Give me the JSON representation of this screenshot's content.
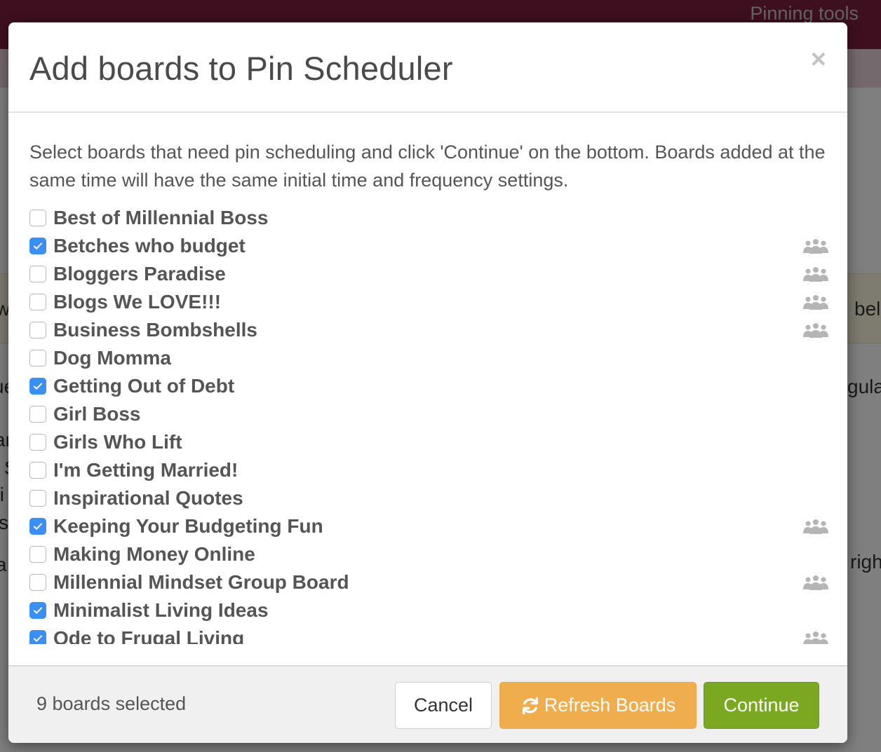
{
  "background": {
    "nav_link": "Pinning tools",
    "fragments_left": [
      "wc",
      "ue",
      "ar",
      "S",
      "ti",
      "s",
      "a"
    ],
    "fragments_right": [
      "belo",
      "gular",
      "righ"
    ]
  },
  "modal": {
    "title": "Add boards to Pin Scheduler",
    "close_label": "×",
    "intro": "Select boards that need pin scheduling and click 'Continue' on the bottom. Boards added at the same time will have the same initial time and frequency settings.",
    "boards": [
      {
        "name": "Best of Millennial Boss",
        "checked": false,
        "group": false
      },
      {
        "name": "Betches who budget",
        "checked": true,
        "group": true
      },
      {
        "name": "Bloggers Paradise",
        "checked": false,
        "group": true
      },
      {
        "name": "Blogs We LOVE!!!",
        "checked": false,
        "group": true
      },
      {
        "name": "Business Bombshells",
        "checked": false,
        "group": true
      },
      {
        "name": "Dog Momma",
        "checked": false,
        "group": false
      },
      {
        "name": "Getting Out of Debt",
        "checked": true,
        "group": false
      },
      {
        "name": "Girl Boss",
        "checked": false,
        "group": false
      },
      {
        "name": "Girls Who Lift",
        "checked": false,
        "group": false
      },
      {
        "name": "I'm Getting Married!",
        "checked": false,
        "group": false
      },
      {
        "name": "Inspirational Quotes",
        "checked": false,
        "group": false
      },
      {
        "name": "Keeping Your Budgeting Fun",
        "checked": true,
        "group": true
      },
      {
        "name": "Making Money Online",
        "checked": false,
        "group": false
      },
      {
        "name": "Millennial Mindset Group Board",
        "checked": false,
        "group": true
      },
      {
        "name": "Minimalist Living Ideas",
        "checked": true,
        "group": false
      },
      {
        "name": "Ode to Frugal Living",
        "checked": true,
        "group": true
      }
    ],
    "footer": {
      "selected_count": "9 boards selected",
      "cancel_label": "Cancel",
      "refresh_label": "Refresh Boards",
      "continue_label": "Continue"
    }
  },
  "colors": {
    "checkbox_checked": "#3a8ff0",
    "refresh_button": "#f0ad4e",
    "continue_button": "#7aa820",
    "topbar": "#7c1f3f"
  }
}
